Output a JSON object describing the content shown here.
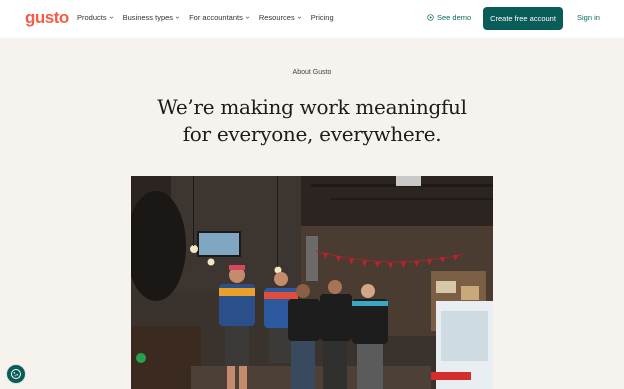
{
  "nav": {
    "logo": "gusto",
    "links": [
      {
        "label": "Products",
        "has_menu": true
      },
      {
        "label": "Business types",
        "has_menu": true
      },
      {
        "label": "For accountants",
        "has_menu": true
      },
      {
        "label": "Resources",
        "has_menu": true
      },
      {
        "label": "Pricing",
        "has_menu": false
      }
    ],
    "see_demo": "See demo",
    "cta": "Create free account",
    "signin": "Sign in"
  },
  "hero": {
    "eyebrow": "About Gusto",
    "headline_line1": "We’re making work meaningful",
    "headline_line2": "for everyone, everywhere."
  },
  "colors": {
    "brand": "#f45d48",
    "accent": "#0a5c58",
    "background": "#f6f3ee"
  },
  "icons": {
    "demo": "play-circle-icon",
    "chevron": "chevron-down-icon",
    "cookie": "cookie-icon"
  }
}
